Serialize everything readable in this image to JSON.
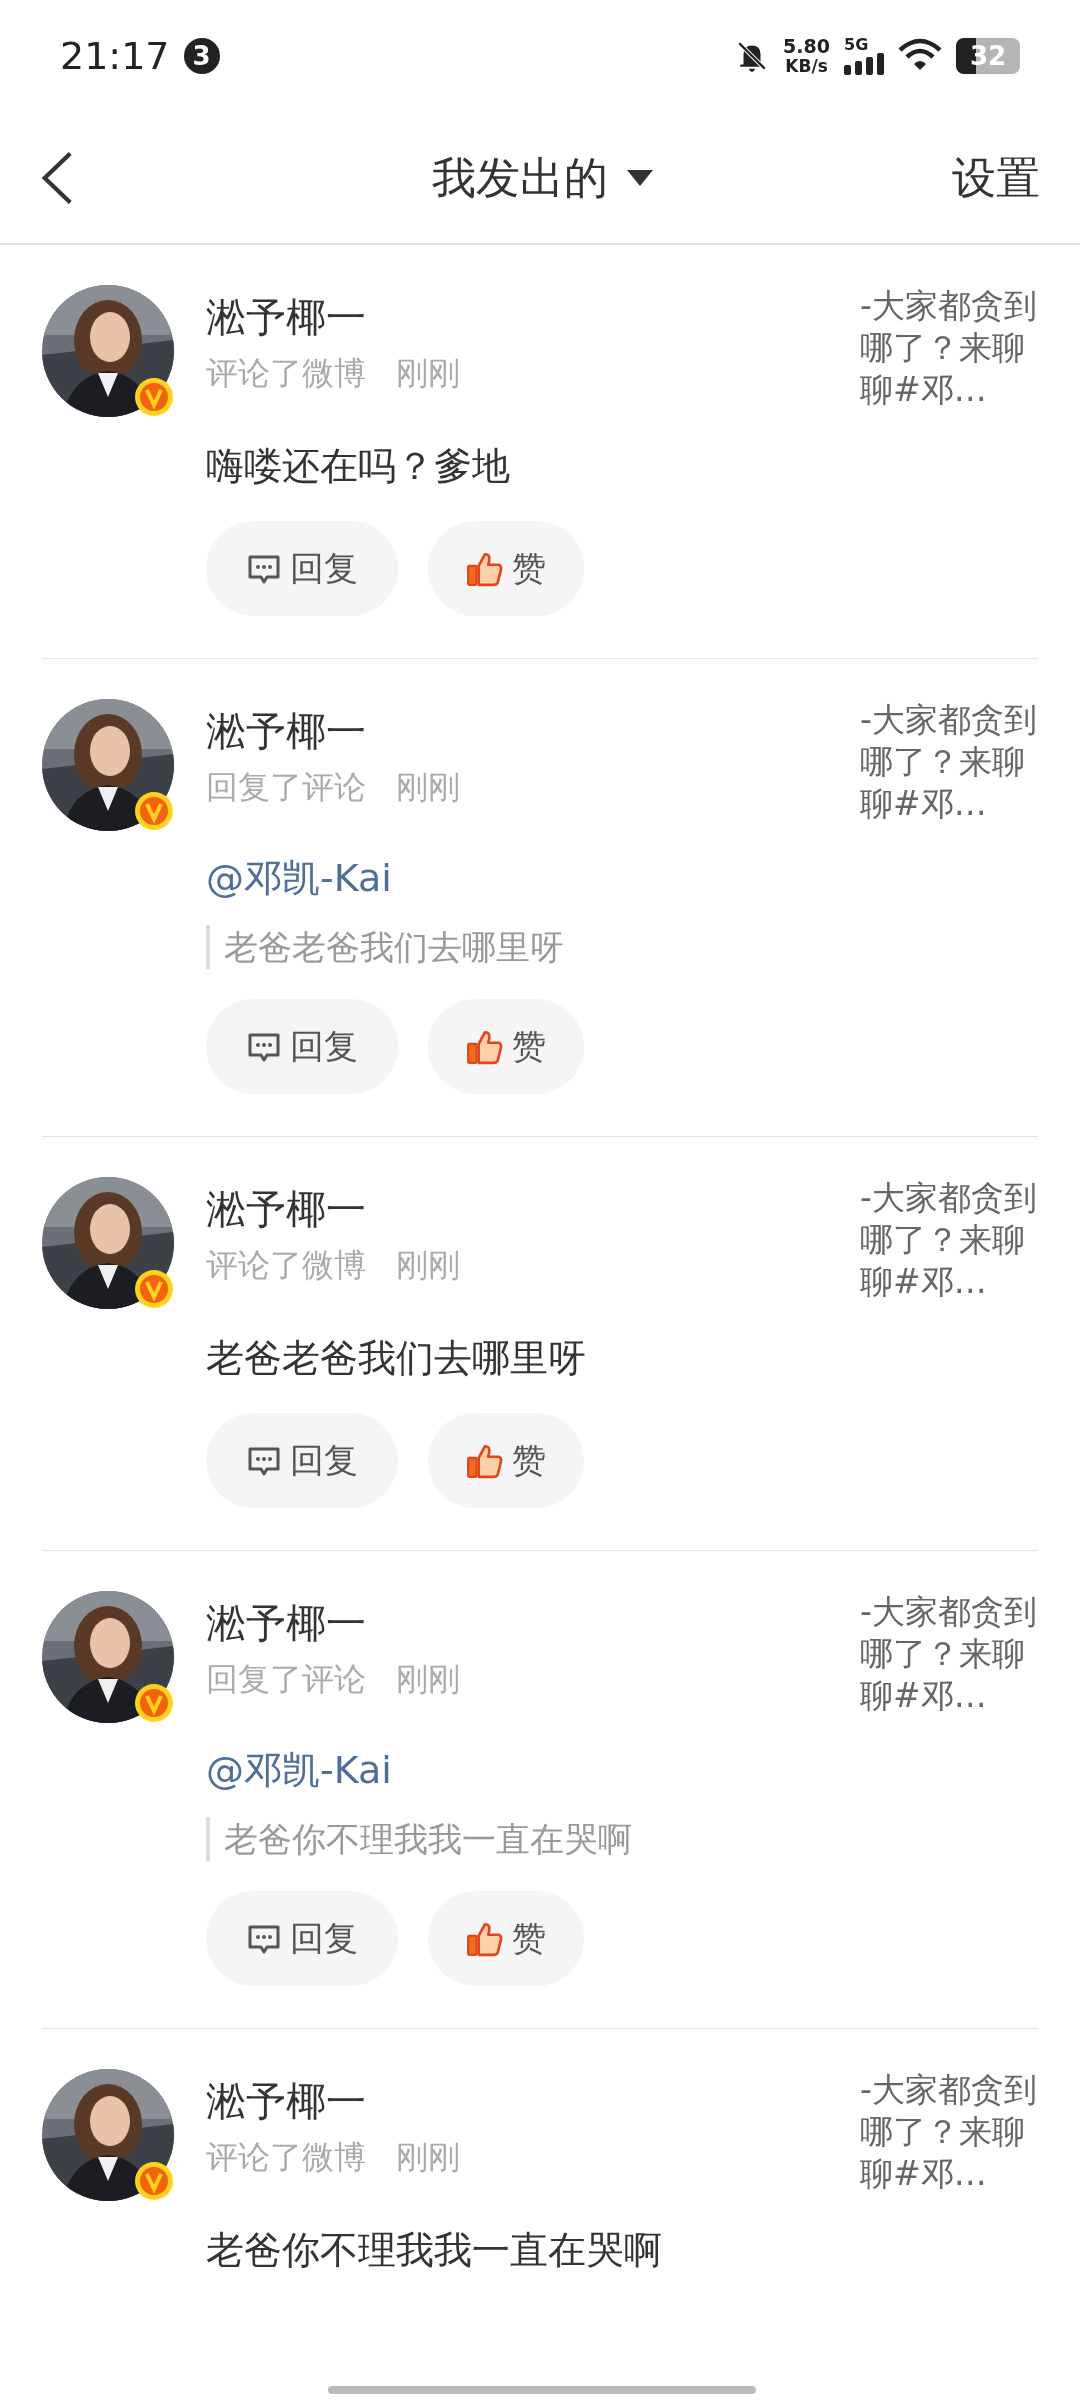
{
  "status_bar": {
    "time": "21:17",
    "notification_count": "3",
    "speed_value": "5.80",
    "speed_unit": "KB/s",
    "network": "5G",
    "battery": "32"
  },
  "header": {
    "title": "我发出的",
    "settings": "设置"
  },
  "items": [
    {
      "kind": "comment",
      "name": "淞予椰一",
      "action": "评论了微博",
      "time": "刚刚",
      "body": "嗨喽还在吗？爹地",
      "source": "-大家都贪到哪了？来聊聊#邓…",
      "reply": "回复",
      "like": "赞"
    },
    {
      "kind": "reply",
      "name": "淞予椰一",
      "action": "回复了评论",
      "time": "刚刚",
      "mention": "@邓凯-Kai",
      "quote": "老爸老爸我们去哪里呀",
      "source": "-大家都贪到哪了？来聊聊#邓…",
      "reply": "回复",
      "like": "赞"
    },
    {
      "kind": "comment",
      "name": "淞予椰一",
      "action": "评论了微博",
      "time": "刚刚",
      "body": "老爸老爸我们去哪里呀",
      "source": "-大家都贪到哪了？来聊聊#邓…",
      "reply": "回复",
      "like": "赞"
    },
    {
      "kind": "reply",
      "name": "淞予椰一",
      "action": "回复了评论",
      "time": "刚刚",
      "mention": "@邓凯-Kai",
      "quote": "老爸你不理我我一直在哭啊",
      "source": "-大家都贪到哪了？来聊聊#邓…",
      "reply": "回复",
      "like": "赞"
    },
    {
      "kind": "comment",
      "name": "淞予椰一",
      "action": "评论了微博",
      "time": "刚刚",
      "body": "老爸你不理我我一直在哭啊",
      "source": "-大家都贪到哪了？来聊聊#邓…"
    }
  ]
}
